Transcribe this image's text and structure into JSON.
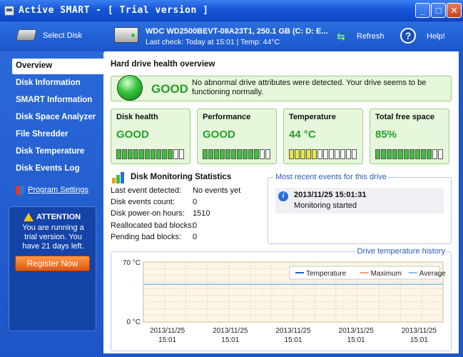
{
  "window": {
    "title": "Active SMART - [ Trial version ]",
    "btn_min": "_",
    "btn_max": "□",
    "btn_close": "✕"
  },
  "toolbar": {
    "select_disk": "Select Disk",
    "drive_name": "WDC WD2500BEVT-08A23T1, 250.1 GB (C: D: E...",
    "last_check": "Last check: Today at 15:01 | Temp: 44°C",
    "refresh": "Refresh",
    "help": "Help!",
    "help_glyph": "?"
  },
  "sidebar": {
    "items": [
      {
        "label": "Overview",
        "active": true
      },
      {
        "label": "Disk Information",
        "active": false
      },
      {
        "label": "SMART Information",
        "active": false
      },
      {
        "label": "Disk Space Analyzer",
        "active": false
      },
      {
        "label": "File Shredder",
        "active": false
      },
      {
        "label": "Disk Temperature",
        "active": false
      },
      {
        "label": "Disk Events Log",
        "active": false
      }
    ],
    "program_settings": "Program Settings",
    "attention_title": "ATTENTION",
    "attention_msg": "You are running a trial version. You have 21 days left.",
    "register_btn": "Register Now"
  },
  "main": {
    "title": "Hard drive health overview",
    "status_word": "GOOD",
    "status_msg": "No abnormal drive attributes were detected. Your drive seems to be functioning normally.",
    "cards": [
      {
        "label": "Disk health",
        "value": "GOOD",
        "level": 0.8,
        "meter_color": "#3fbf3a"
      },
      {
        "label": "Performance",
        "value": "GOOD",
        "level": 0.8,
        "meter_color": "#3fbf3a"
      },
      {
        "label": "Temperature",
        "value": "44 °C",
        "level": 0.4,
        "meter_color": "#e8e83a"
      },
      {
        "label": "Total free space",
        "value": "85%",
        "level": 0.85,
        "meter_color": "#3fbf3a"
      }
    ],
    "stats_title": "Disk Monitoring Statistics",
    "stats": [
      {
        "label": "Last event detected:",
        "value": "No events yet"
      },
      {
        "label": "Disk events count:",
        "value": "0"
      },
      {
        "label": "Disk power-on hours:",
        "value": "1510"
      },
      {
        "label": "Reallocated bad blocks:",
        "value": "0"
      },
      {
        "label": "Pending bad blocks:",
        "value": "0"
      }
    ],
    "events_title": "Most recent events for this drive",
    "event": {
      "time": "2013/11/25 15:01:31",
      "message": "Monitoring started"
    },
    "chart_title": "Drive temperature history"
  },
  "chart_data": {
    "type": "line",
    "title": "Drive temperature history",
    "ylim": [
      0,
      70
    ],
    "y_ticks": [
      "70 °C",
      "0 °C"
    ],
    "x_ticks": [
      [
        "2013/11/25",
        "15:01"
      ],
      [
        "2013/11/25",
        "15:01"
      ],
      [
        "2013/11/25",
        "15:01"
      ],
      [
        "2013/11/25",
        "15:01"
      ],
      [
        "2013/11/25",
        "15:01"
      ]
    ],
    "series": [
      {
        "name": "Temperature",
        "color": "#1f5fc8",
        "values": [
          44,
          44,
          44,
          44,
          44
        ]
      },
      {
        "name": "Maximum",
        "color": "#f0a070",
        "values": [
          44,
          44,
          44,
          44,
          44
        ]
      },
      {
        "name": "Average",
        "color": "#80c0e8",
        "values": [
          44,
          44,
          44,
          44,
          44
        ]
      }
    ],
    "legend": "top-right",
    "grid": true
  }
}
